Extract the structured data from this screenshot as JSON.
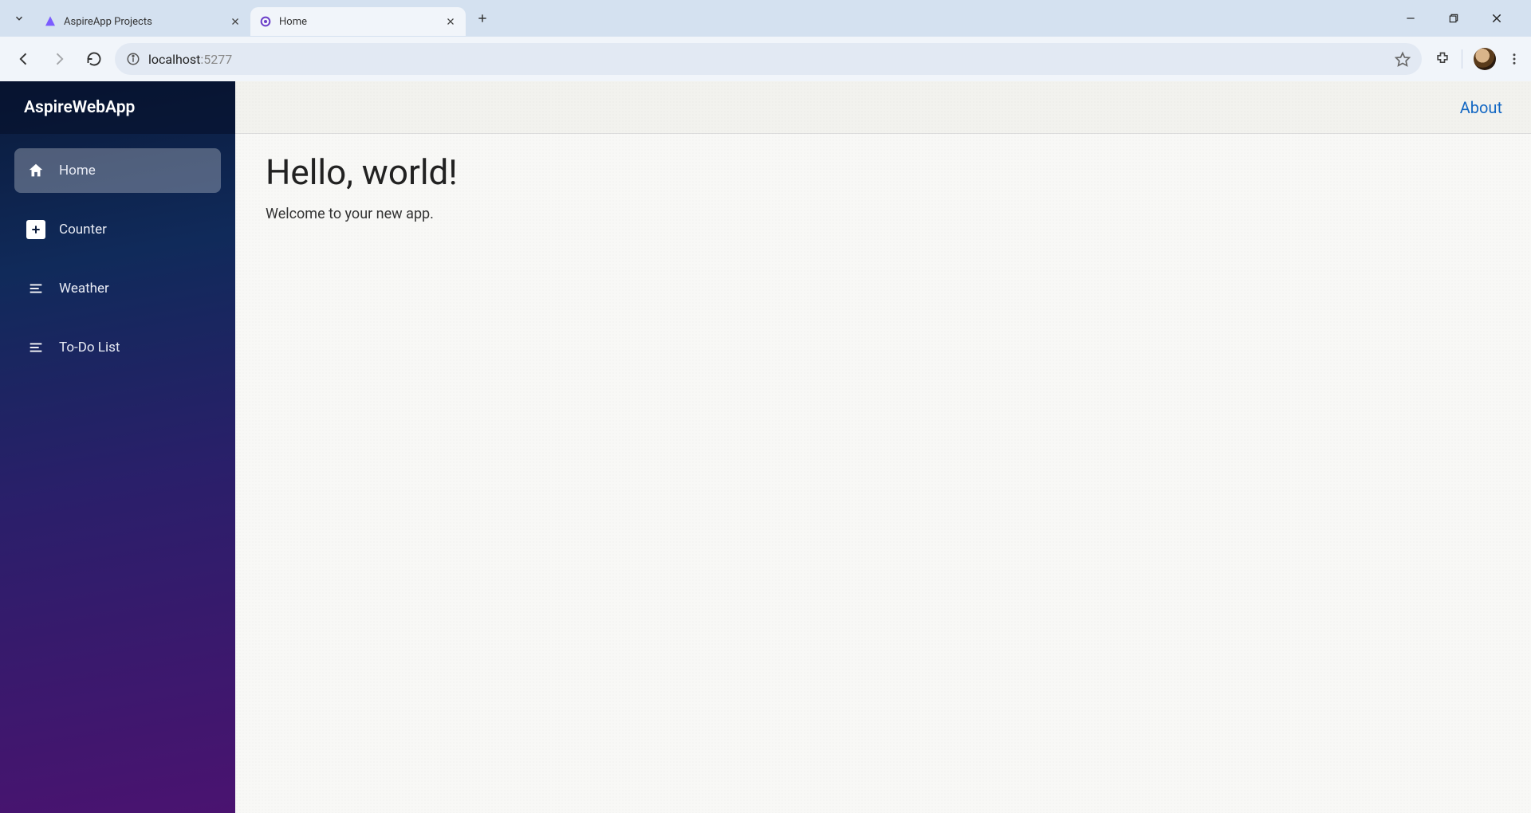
{
  "browser": {
    "tabs": [
      {
        "title": "AspireApp Projects",
        "active": false
      },
      {
        "title": "Home",
        "active": true
      }
    ],
    "url_host": "localhost",
    "url_port": ":5277"
  },
  "app": {
    "brand": "AspireWebApp",
    "topbar": {
      "about": "About"
    },
    "sidebar": {
      "items": [
        {
          "label": "Home",
          "icon": "home-icon",
          "active": true
        },
        {
          "label": "Counter",
          "icon": "plus-icon",
          "active": false
        },
        {
          "label": "Weather",
          "icon": "list-icon",
          "active": false
        },
        {
          "label": "To-Do List",
          "icon": "list-icon",
          "active": false
        }
      ]
    },
    "page": {
      "heading": "Hello, world!",
      "subtext": "Welcome to your new app."
    }
  }
}
